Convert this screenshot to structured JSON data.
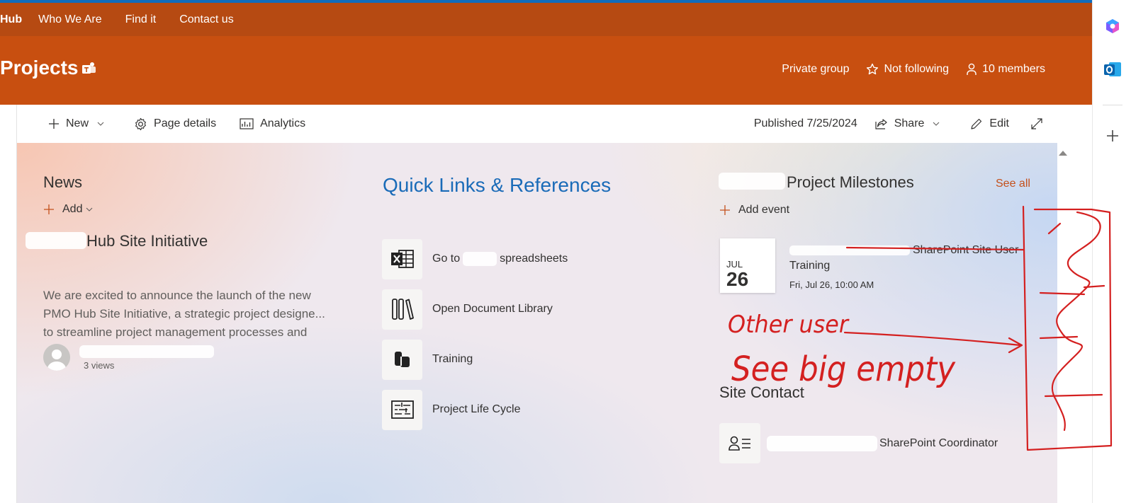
{
  "hub_nav": {
    "brand": "Hub",
    "items": [
      "Who We Are",
      "Find it",
      "Contact us"
    ]
  },
  "site_header": {
    "title": "Projects",
    "privacy": "Private group",
    "follow": "Not following",
    "members": "10 members"
  },
  "command_bar": {
    "new_label": "New",
    "page_details_label": "Page details",
    "analytics_label": "Analytics",
    "published": "Published 7/25/2024",
    "share_label": "Share",
    "edit_label": "Edit"
  },
  "news": {
    "heading": "News",
    "add_label": "Add",
    "article_title": "Hub Site Initiative",
    "desc_line1": "We are excited to announce the launch of the new",
    "desc_line2": "PMO Hub Site Initiative, a strategic project designe...",
    "desc_line3": "to streamline project management processes and",
    "views": "3 views"
  },
  "quick_links": {
    "heading": "Quick Links & References",
    "items": [
      {
        "label": "Go to",
        "label_suffix": "spreadsheets",
        "icon": "excel-icon"
      },
      {
        "label": "Open Document Library",
        "icon": "library-icon"
      },
      {
        "label": "Training",
        "icon": "training-icon"
      },
      {
        "label": "Project Life Cycle",
        "icon": "lifecycle-icon"
      }
    ]
  },
  "milestones": {
    "heading": "Project Milestones",
    "see_all": "See all",
    "add_event": "Add event",
    "event": {
      "month": "JUL",
      "day": "26",
      "title_suffix": "SharePoint Site User",
      "title_line2": "Training",
      "time": "Fri, Jul 26, 10:00 AM"
    }
  },
  "site_contact": {
    "heading": "Site Contact",
    "role": "SharePoint Coordinator"
  },
  "annotation": {
    "line1": "Other user",
    "line2": "See big empty",
    "color": "#d42020"
  },
  "colors": {
    "hub_nav_bg": "#b64a12",
    "header_bg": "#c84f10",
    "accent_link": "#1a6bb8",
    "see_all": "#c4501b"
  }
}
